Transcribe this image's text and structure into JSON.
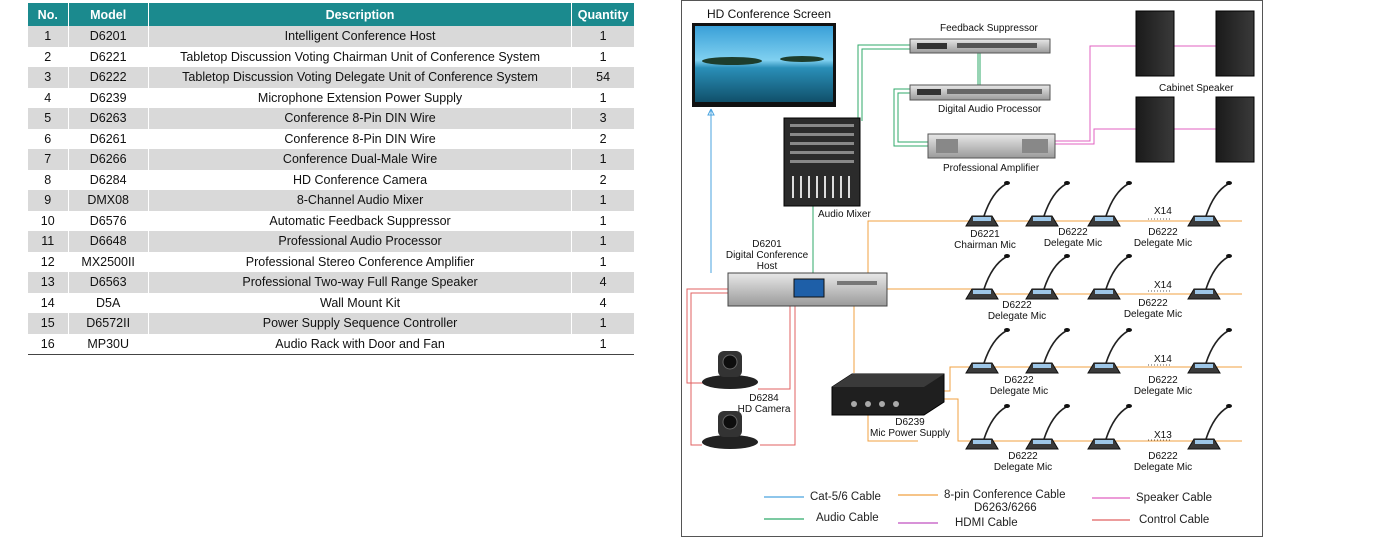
{
  "table": {
    "headers": [
      "No.",
      "Model",
      "Description",
      "Quantity"
    ],
    "rows": [
      [
        "1",
        "D6201",
        "Intelligent Conference Host",
        "1"
      ],
      [
        "2",
        "D6221",
        "Tabletop Discussion Voting Chairman Unit of Conference System",
        "1"
      ],
      [
        "3",
        "D6222",
        "Tabletop Discussion Voting Delegate Unit of Conference System",
        "54"
      ],
      [
        "4",
        "D6239",
        "Microphone Extension Power Supply",
        "1"
      ],
      [
        "5",
        "D6263",
        "Conference 8-Pin DIN Wire",
        "3"
      ],
      [
        "6",
        "D6261",
        "Conference 8-Pin DIN Wire",
        "2"
      ],
      [
        "7",
        "D6266",
        "Conference Dual-Male Wire",
        "1"
      ],
      [
        "8",
        "D6284",
        "HD Conference Camera",
        "2"
      ],
      [
        "9",
        "DMX08",
        "8-Channel Audio Mixer",
        "1"
      ],
      [
        "10",
        "D6576",
        "Automatic Feedback Suppressor",
        "1"
      ],
      [
        "11",
        "D6648",
        "Professional Audio Processor",
        "1"
      ],
      [
        "12",
        "MX2500II",
        "Professional Stereo Conference Amplifier",
        "1"
      ],
      [
        "13",
        "D6563",
        "Professional Two-way Full Range Speaker",
        "4"
      ],
      [
        "14",
        "D5A",
        "Wall Mount Kit",
        "4"
      ],
      [
        "15",
        "D6572II",
        "Power Supply Sequence Controller",
        "1"
      ],
      [
        "16",
        "MP30U",
        "Audio Rack with Door and Fan",
        "1"
      ]
    ]
  },
  "diagram": {
    "screen_title": "HD Conference Screen",
    "feedback_suppressor": "Feedback Suppressor",
    "digital_audio_processor": "Digital Audio Processor",
    "professional_amplifier": "Professional Amplifier",
    "cabinet_speaker": "Cabinet Speaker",
    "audio_mixer": "Audio Mixer",
    "host_model": "D6201",
    "host_name_1": "Digital Conference",
    "host_name_2": "Host",
    "camera_model": "D6284",
    "camera_name": "HD Camera",
    "power_model": "D6239",
    "power_name": "Mic Power Supply",
    "chairman_model": "D6221",
    "chairman_name": "Chairman Mic",
    "delegate_model": "D6222",
    "delegate_name": "Delegate Mic",
    "mic_rows": [
      {
        "mult": "X14"
      },
      {
        "mult": "X14"
      },
      {
        "mult": "X14"
      },
      {
        "mult": "X13"
      }
    ]
  },
  "legend": {
    "cat": "Cat-5/6 Cable",
    "audio": "Audio Cable",
    "conf1": "8-pin Conference Cable",
    "conf2": "D6263/6266",
    "hdmi": "HDMI Cable",
    "speaker": "Speaker Cable",
    "control": "Control Cable"
  },
  "colors": {
    "header_bg": "#1b8a8e",
    "cat_cable": "#4aa3df",
    "audio_cable": "#2faa6a",
    "conference_cable": "#f0a040",
    "hdmi_cable": "#c050c0",
    "speaker_cable": "#e060c0",
    "control_cable": "#e06060"
  }
}
